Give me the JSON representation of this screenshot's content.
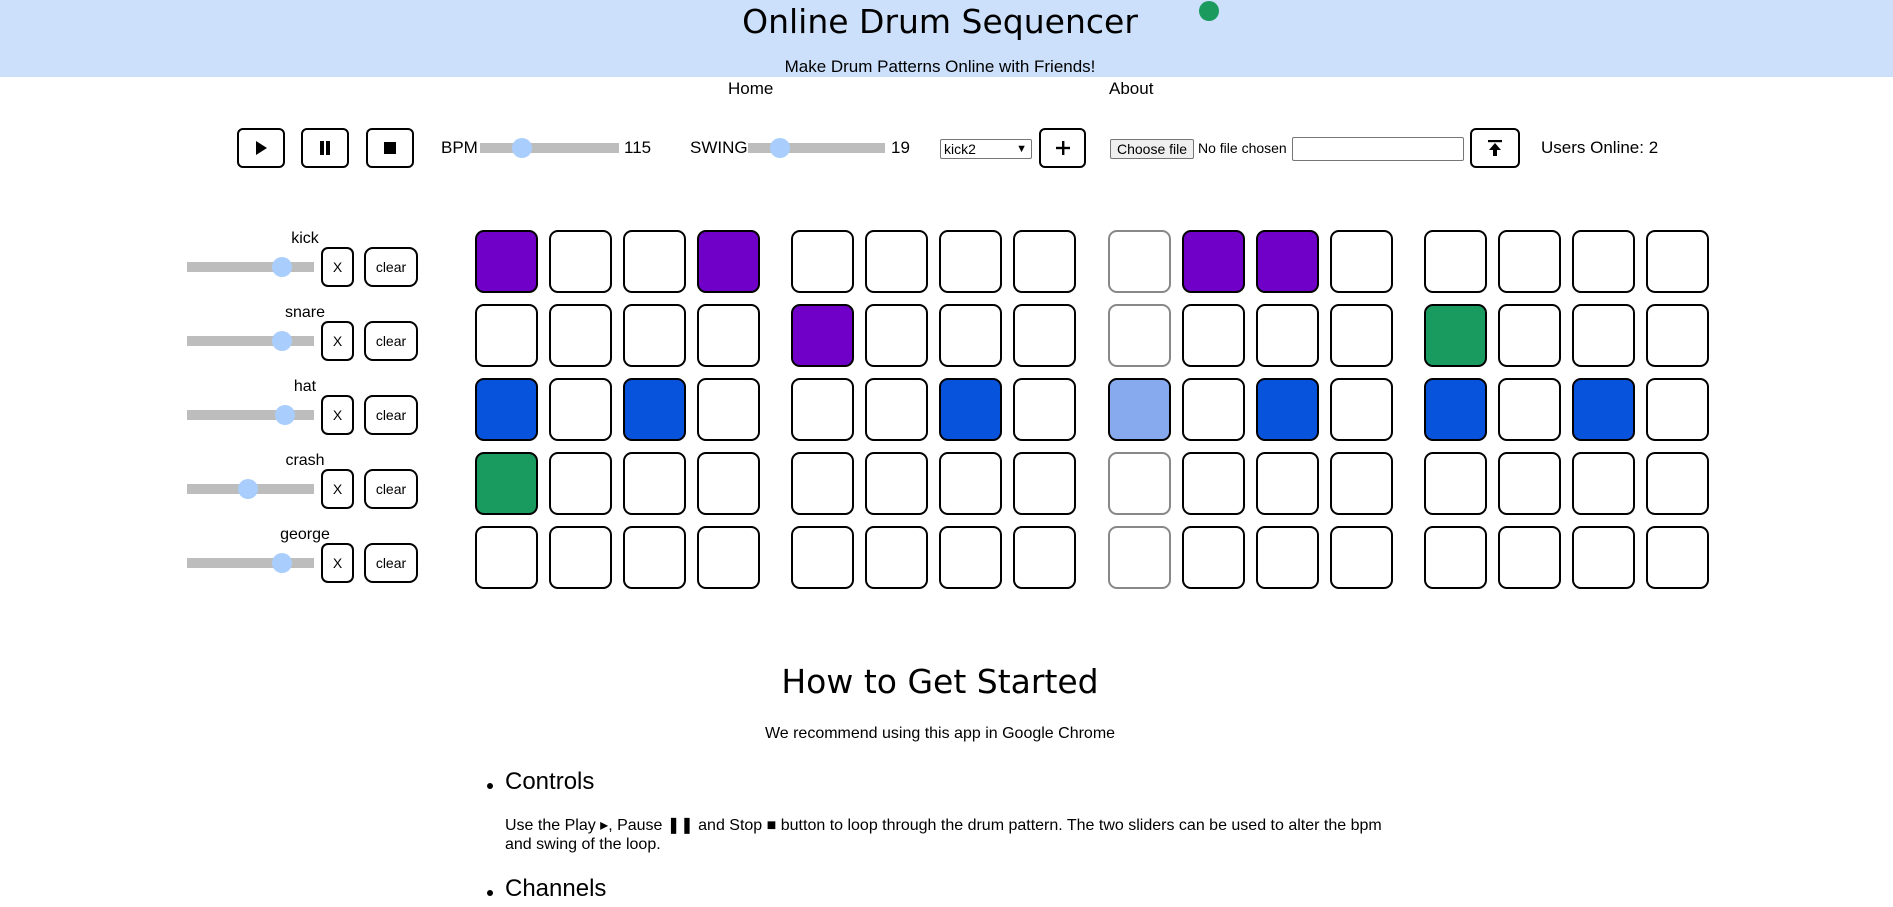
{
  "header": {
    "title": "Online Drum Sequencer",
    "subtitle": "Make Drum Patterns Online with Friends!",
    "status_color": "#1a9a5c",
    "background": "#cce0fb"
  },
  "nav": {
    "home": "Home",
    "about": "About"
  },
  "transport": {
    "play_icon": "play-icon",
    "pause_icon": "pause-icon",
    "stop_icon": "stop-icon"
  },
  "bpm": {
    "label": "BPM",
    "value": "115",
    "level": 0.3
  },
  "swing": {
    "label": "SWING",
    "value": "19",
    "level": 0.23
  },
  "sample": {
    "selected": "kick2",
    "add_icon": "plus-icon"
  },
  "upload": {
    "choose_label": "Choose file",
    "status": "No file chosen",
    "text_value": "",
    "upload_icon": "upload-icon"
  },
  "users": {
    "label": "Users Online: 2"
  },
  "channels": [
    {
      "name": "kick",
      "volume": 0.75,
      "mute": "X",
      "clear": "clear",
      "steps": [
        1,
        0,
        0,
        1,
        0,
        0,
        0,
        0,
        0,
        1,
        1,
        0,
        0,
        0,
        0,
        0
      ]
    },
    {
      "name": "snare",
      "volume": 0.75,
      "mute": "X",
      "clear": "clear",
      "steps": [
        0,
        0,
        0,
        0,
        1,
        0,
        0,
        0,
        0,
        0,
        0,
        0,
        3,
        0,
        0,
        0
      ]
    },
    {
      "name": "hat",
      "volume": 0.77,
      "mute": "X",
      "clear": "clear",
      "steps": [
        2,
        0,
        2,
        0,
        0,
        0,
        2,
        0,
        4,
        0,
        2,
        0,
        2,
        0,
        2,
        0
      ]
    },
    {
      "name": "crash",
      "volume": 0.48,
      "mute": "X",
      "clear": "clear",
      "steps": [
        3,
        0,
        0,
        0,
        0,
        0,
        0,
        0,
        0,
        0,
        0,
        0,
        0,
        0,
        0,
        0
      ]
    },
    {
      "name": "george",
      "volume": 0.75,
      "mute": "X",
      "clear": "clear",
      "steps": [
        0,
        0,
        0,
        0,
        0,
        0,
        0,
        0,
        0,
        0,
        0,
        0,
        0,
        0,
        0,
        0
      ]
    }
  ],
  "playhead_step": 9,
  "step_colors": {
    "0": "#ffffff",
    "1": "#7000c8",
    "2": "#0853dc",
    "3": "#199a5f",
    "4": "#87aaee"
  },
  "help": {
    "title": "How to Get Started",
    "recommend": "We recommend using this app in Google Chrome",
    "controls_heading": "Controls",
    "controls_text": "Use the Play ▸, Pause ❚❚ and Stop ■ button to loop through the drum pattern. The two sliders can be used to alter the bpm and swing of the loop.",
    "channels_heading": "Channels"
  }
}
